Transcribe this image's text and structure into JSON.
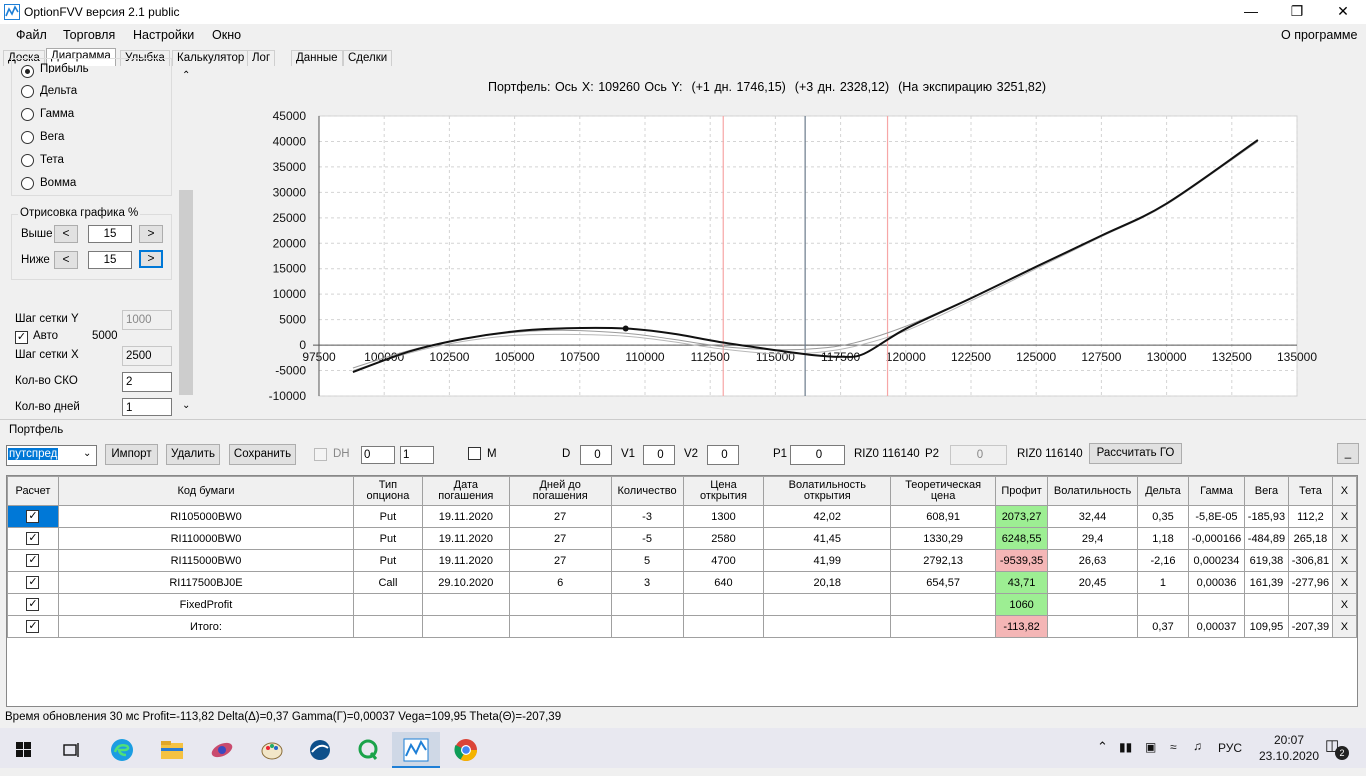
{
  "window": {
    "title": "OptionFVV версия 2.1 public"
  },
  "menu": {
    "items": [
      "Файл",
      "Торговля",
      "Настройки",
      "Окно"
    ],
    "about": "О программе"
  },
  "tabs": [
    "Доска",
    "Диаграмма",
    "Улыбка",
    "Калькулятор",
    "Лог",
    "Данные",
    "Сделки"
  ],
  "left": {
    "radios": [
      "Прибыль",
      "Дельта",
      "Гамма",
      "Вега",
      "Тета",
      "Вомма"
    ],
    "draw_group": "Отрисовка графика %",
    "above_label": "Выше",
    "below_label": "Ниже",
    "above_value": "15",
    "below_value": "15",
    "prev": "<",
    "next": ">",
    "grid_y_label": "Шаг сетки Y",
    "grid_y_value": "1000",
    "auto_label": "Авто",
    "auto_value": "5000",
    "grid_x_label": "Шаг сетки X",
    "grid_x_value": "2500",
    "sko_label": "Кол-во СКО",
    "sko_value": "2",
    "days_label": "Кол-во дней",
    "days_value": "1"
  },
  "chart_header": {
    "portfolio": "Портфель:",
    "axis_x": "Ось X:",
    "x_value": "109260",
    "axis_y": "Ось Y:",
    "d1": "(+1 дн. 1746,15)",
    "d3": "(+3 дн. 2328,12)",
    "exp": "(На экспирацию 3251,82)"
  },
  "chart_data": {
    "type": "line",
    "xlim": [
      97500,
      135000
    ],
    "ylim": [
      -10000,
      45000
    ],
    "x_ticks": [
      97500,
      100000,
      102500,
      105000,
      107500,
      110000,
      112500,
      115000,
      117500,
      120000,
      122500,
      125000,
      127500,
      130000,
      132500,
      135000
    ],
    "y_ticks": [
      45000,
      40000,
      35000,
      30000,
      25000,
      20000,
      15000,
      10000,
      5000,
      0,
      -5000,
      -10000
    ],
    "vlines": [
      {
        "x": 113000,
        "color": "#f7a6a6"
      },
      {
        "x": 116140,
        "color": "#6a7a8a"
      },
      {
        "x": 119300,
        "color": "#f7a6a6"
      }
    ],
    "series": [
      {
        "color": "#111111",
        "width": 2,
        "points": [
          [
            98800,
            -5300
          ],
          [
            101000,
            -1200
          ],
          [
            103000,
            1200
          ],
          [
            105000,
            2700
          ],
          [
            107000,
            3300
          ],
          [
            109260,
            3251
          ],
          [
            111000,
            2300
          ],
          [
            113000,
            500
          ],
          [
            115000,
            -1000
          ],
          [
            116500,
            -2000
          ],
          [
            117500,
            -2300
          ],
          [
            118400,
            -1700
          ],
          [
            120000,
            3200
          ],
          [
            122500,
            9200
          ],
          [
            125000,
            15400
          ],
          [
            127500,
            21500
          ],
          [
            130000,
            27800
          ],
          [
            133500,
            40300
          ]
        ]
      },
      {
        "color": "#9a9a9a",
        "width": 1,
        "points": [
          [
            98800,
            -4500
          ],
          [
            101000,
            -1000
          ],
          [
            103000,
            1200
          ],
          [
            105000,
            2500
          ],
          [
            107000,
            2900
          ],
          [
            109260,
            2328
          ],
          [
            111000,
            1200
          ],
          [
            113000,
            -300
          ],
          [
            115000,
            -900
          ],
          [
            116500,
            -700
          ],
          [
            118000,
            400
          ],
          [
            120000,
            3700
          ],
          [
            122500,
            9300
          ],
          [
            125000,
            15400
          ],
          [
            127500,
            21500
          ],
          [
            130000,
            27800
          ],
          [
            133500,
            40000
          ]
        ]
      },
      {
        "color": "#b8b8b8",
        "width": 1,
        "points": [
          [
            98800,
            -5000
          ],
          [
            101000,
            -1500
          ],
          [
            103000,
            700
          ],
          [
            105000,
            1900
          ],
          [
            107000,
            2100
          ],
          [
            109260,
            1746
          ],
          [
            111000,
            700
          ],
          [
            113000,
            -800
          ],
          [
            115000,
            -1700
          ],
          [
            116500,
            -1500
          ],
          [
            118000,
            -300
          ],
          [
            120000,
            2800
          ],
          [
            122500,
            8700
          ],
          [
            125000,
            15000
          ],
          [
            127500,
            21300
          ],
          [
            130000,
            27600
          ],
          [
            133500,
            40100
          ]
        ]
      }
    ],
    "marker": {
      "x": 109260,
      "y": 3251
    }
  },
  "portfolio": {
    "label": "Портфель",
    "selected": "путспред",
    "import": "Импорт",
    "delete": "Удалить",
    "save": "Сохранить",
    "dh_label": "DH",
    "spin1": "0",
    "spin2": "1",
    "m_label": "M",
    "d_label": "D",
    "d_value": "0",
    "v1_label": "V1",
    "v1_value": "0",
    "v2_label": "V2",
    "v2_value": "0",
    "p1_label": "P1",
    "p1_value": "0",
    "p1_inst": "RIZ0 116140",
    "p2_label": "P2",
    "p2_value": "0",
    "p2_inst": "RIZ0 116140",
    "calc": "Рассчитать ГО",
    "min_btn": "_"
  },
  "table": {
    "headers": [
      "Расчет",
      "Код бумаги",
      "Тип опциона",
      "Дата погашения",
      "Дней до погашения",
      "Количество",
      "Цена открытия",
      "Волатильность открытия",
      "Теоретическая цена",
      "Профит",
      "Волатильность",
      "Дельта",
      "Гамма",
      "Вега",
      "Тета",
      "X"
    ],
    "rows": [
      {
        "code": "RI105000BW0",
        "type": "Put",
        "date": "19.11.2020",
        "days": "27",
        "qty": "-3",
        "price": "1300",
        "vol_open": "42,02",
        "theo": "608,91",
        "profit": "2073,27",
        "vol": "32,44",
        "delta": "0,35",
        "gamma": "-5,8E-05",
        "vega": "-185,93",
        "theta": "112,2",
        "x": "X"
      },
      {
        "code": "RI110000BW0",
        "type": "Put",
        "date": "19.11.2020",
        "days": "27",
        "qty": "-5",
        "price": "2580",
        "vol_open": "41,45",
        "theo": "1330,29",
        "profit": "6248,55",
        "vol": "29,4",
        "delta": "1,18",
        "gamma": "-0,000166",
        "vega": "-484,89",
        "theta": "265,18",
        "x": "X"
      },
      {
        "code": "RI115000BW0",
        "type": "Put",
        "date": "19.11.2020",
        "days": "27",
        "qty": "5",
        "price": "4700",
        "vol_open": "41,99",
        "theo": "2792,13",
        "profit": "-9539,35",
        "vol": "26,63",
        "delta": "-2,16",
        "gamma": "0,000234",
        "vega": "619,38",
        "theta": "-306,81",
        "x": "X"
      },
      {
        "code": "RI117500BJ0E",
        "type": "Call",
        "date": "29.10.2020",
        "days": "6",
        "qty": "3",
        "price": "640",
        "vol_open": "20,18",
        "theo": "654,57",
        "profit": "43,71",
        "vol": "20,45",
        "delta": "1",
        "gamma": "0,00036",
        "vega": "161,39",
        "theta": "-277,96",
        "x": "X"
      },
      {
        "code": "FixedProfit",
        "type": "",
        "date": "",
        "days": "",
        "qty": "",
        "price": "",
        "vol_open": "",
        "theo": "",
        "profit": "1060",
        "vol": "",
        "delta": "",
        "gamma": "",
        "vega": "",
        "theta": "",
        "x": "X"
      },
      {
        "code": "Итого:",
        "type": "",
        "date": "",
        "days": "",
        "qty": "",
        "price": "",
        "vol_open": "",
        "theo": "",
        "profit": "-113,82",
        "vol": "",
        "delta": "0,37",
        "gamma": "0,00037",
        "vega": "109,95",
        "theta": "-207,39",
        "x": "X"
      }
    ]
  },
  "status": "Время обновления 30 мс  Profit=-113,82 Delta(Δ)=0,37 Gamma(Γ)=0,00037 Vega=109,95 Theta(Θ)=-207,39",
  "taskbar": {
    "lang": "РУС",
    "time": "20:07",
    "date": "23.10.2020",
    "notif": "2"
  }
}
